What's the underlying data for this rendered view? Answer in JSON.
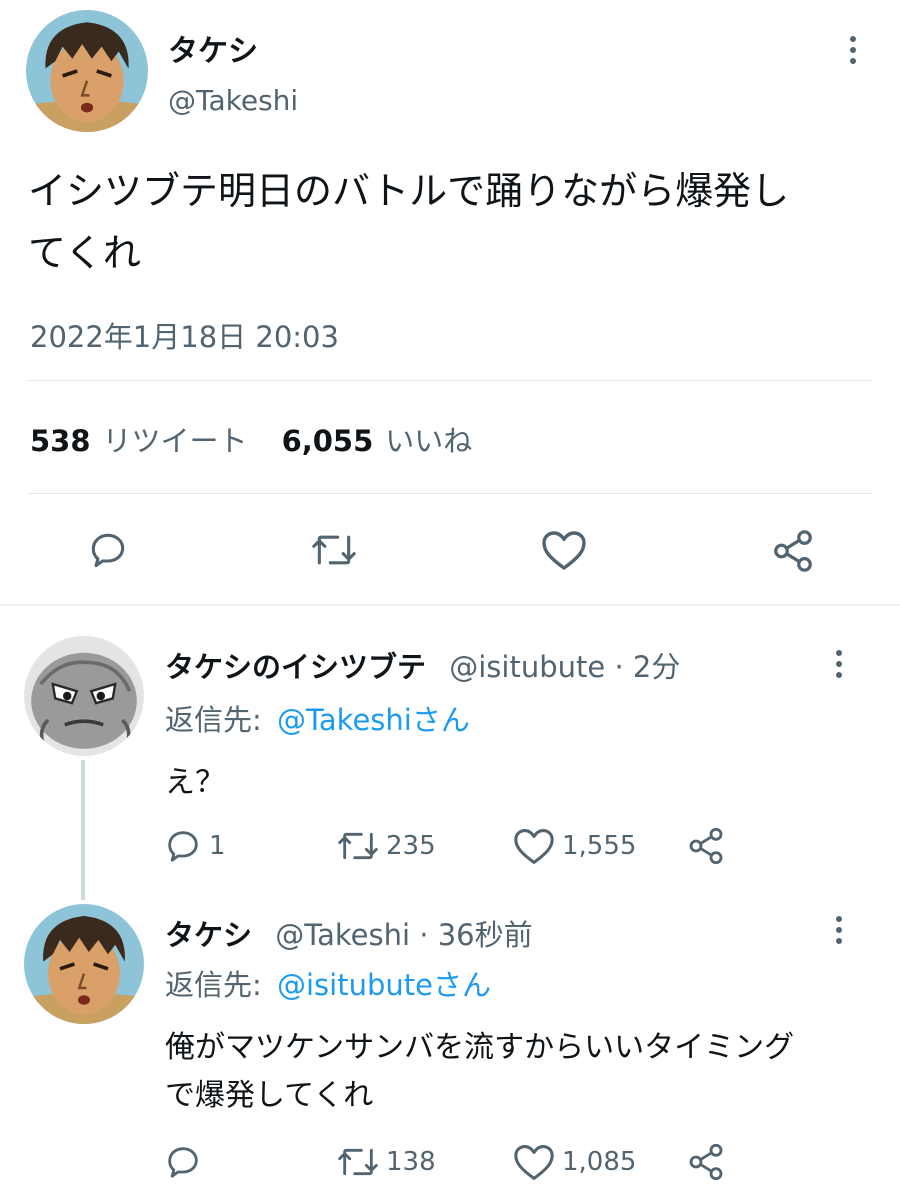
{
  "main_tweet": {
    "display_name": "タケシ",
    "handle": "@Takeshi",
    "text_line1": "イシツブテ明日のバトルで踊りながら爆発し",
    "text_line2": "てくれ",
    "timestamp": "2022年1月18日 20:03",
    "retweet_count": "538",
    "retweet_label": "リツイート",
    "like_count": "6,055",
    "like_label": "いいね"
  },
  "replies": [
    {
      "display_name": "タケシのイシツブテ",
      "handle": "@isitubute",
      "separator": "·",
      "time": "2分",
      "reply_prefix": "返信先:",
      "reply_to": "@Takeshiさん",
      "text_line1": "え？",
      "reply_count": "1",
      "retweet_count": "235",
      "like_count": "1,555"
    },
    {
      "display_name": "タケシ",
      "handle": "@Takeshi",
      "separator": "·",
      "time": "36秒前",
      "reply_prefix": "返信先:",
      "reply_to": "@isitubuteさん",
      "text_line1": "俺がマツケンサンバを流すからいいタイミング",
      "text_line2": "で爆発してくれ",
      "reply_count": "",
      "retweet_count": "138",
      "like_count": "1,085"
    }
  ],
  "icons": [
    "more-icon",
    "reply-icon",
    "retweet-icon",
    "like-icon",
    "share-icon"
  ],
  "colors": {
    "text": "#0f1419",
    "muted": "#536471",
    "link": "#1d9bf0",
    "divider": "#e6e9eb"
  }
}
